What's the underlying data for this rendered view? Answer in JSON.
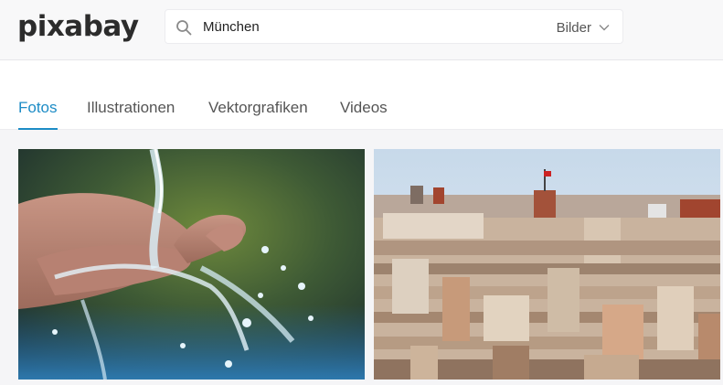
{
  "header": {
    "logo": "pixabay",
    "search": {
      "value": "München",
      "type_selected": "Bilder"
    }
  },
  "tabs": [
    {
      "label": "Fotos",
      "active": true
    },
    {
      "label": "Illustrationen",
      "active": false
    },
    {
      "label": "Vektorgrafiken",
      "active": false
    },
    {
      "label": "Videos",
      "active": false
    }
  ],
  "colors": {
    "accent": "#1d8cc6",
    "text": "#555555"
  },
  "gallery": {
    "photos": [
      {
        "subject": "hands-water"
      },
      {
        "subject": "city-rooftops"
      }
    ]
  }
}
